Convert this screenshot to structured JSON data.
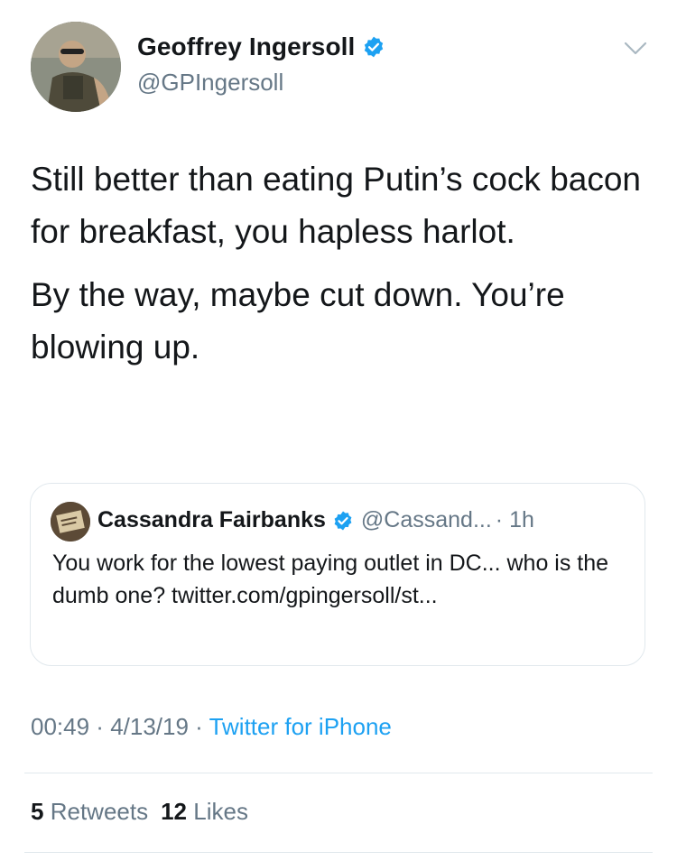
{
  "author": {
    "display_name": "Geoffrey Ingersoll",
    "handle": "@GPIngersoll",
    "verified": true
  },
  "tweet": {
    "paragraphs": [
      "Still better than eating Putin’s cock bacon for breakfast, you hapless harlot.",
      "By the way, maybe cut down. You’re blowing up."
    ]
  },
  "quoted_tweet": {
    "display_name": "Cassandra Fairbanks",
    "handle": "@Cassand...",
    "time": "· 1h",
    "text": "You work for the lowest paying outlet in DC... who is the dumb one? twitter.com/gpingersoll/st..."
  },
  "meta": {
    "time": "00:49",
    "separator1": " · ",
    "date": "4/13/19",
    "separator2": " · ",
    "source": "Twitter for iPhone"
  },
  "stats": {
    "retweets_count": "5",
    "retweets_label": "Retweets",
    "likes_count": "12",
    "likes_label": "Likes"
  },
  "colors": {
    "accent": "#1da1f2",
    "secondary_text": "#657786",
    "divider": "#e1e8ed"
  },
  "icons": {
    "verified": "verified-badge-icon",
    "caret": "chevron-down-icon"
  }
}
